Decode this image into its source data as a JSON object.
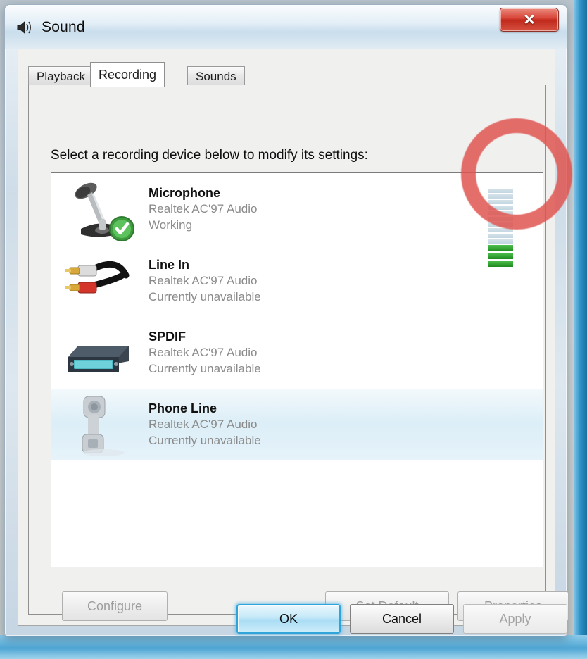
{
  "window": {
    "title": "Sound",
    "icon": "speaker-icon",
    "close_label": "x"
  },
  "tabs": [
    {
      "label": "Playback",
      "active": false
    },
    {
      "label": "Recording",
      "active": true
    },
    {
      "label": "Sounds",
      "active": false
    }
  ],
  "instruction": "Select a recording device below to modify its settings:",
  "devices": [
    {
      "name": "Microphone",
      "driver": "Realtek AC'97 Audio",
      "status": "Working",
      "icon": "microphone-icon",
      "badge": "green-check-badge",
      "selected": false,
      "has_meter": true
    },
    {
      "name": "Line In",
      "driver": "Realtek AC'97 Audio",
      "status": "Currently unavailable",
      "icon": "rca-cable-icon",
      "badge": null,
      "selected": false,
      "has_meter": false
    },
    {
      "name": "SPDIF",
      "driver": "Realtek AC'97 Audio",
      "status": "Currently unavailable",
      "icon": "spdif-device-icon",
      "badge": null,
      "selected": false,
      "has_meter": false
    },
    {
      "name": "Phone Line",
      "driver": "Realtek AC'97 Audio",
      "status": "Currently unavailable",
      "icon": "telephone-handset-icon",
      "badge": null,
      "selected": true,
      "has_meter": false
    }
  ],
  "volume_meter": {
    "total_segments": 13,
    "active_segments": 3,
    "inactive_segments": 10,
    "active_color": "#2f9e2f",
    "inactive_color": "#c8dbe5"
  },
  "annotation": {
    "shape": "circle",
    "color": "#df524e",
    "target": "volume-meter"
  },
  "buttons": {
    "configure": {
      "label": "Configure",
      "disabled": true
    },
    "set_default": {
      "label": "Set Default",
      "disabled": true
    },
    "properties": {
      "label": "Properties",
      "disabled": true
    },
    "ok": {
      "label": "OK",
      "default": true
    },
    "cancel": {
      "label": "Cancel",
      "default": false
    },
    "apply": {
      "label": "Apply",
      "disabled": true
    }
  }
}
